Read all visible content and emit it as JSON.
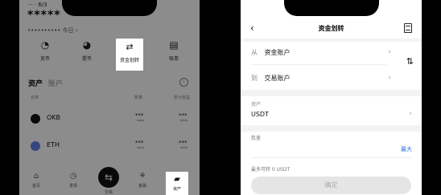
{
  "left": {
    "header_fragment": "··· · 6/3",
    "balance_masked": "*****",
    "balance_sub": "•••••••••• 今日 ›",
    "actions": [
      {
        "label": "充币",
        "icon": "deposit-icon"
      },
      {
        "label": "提币",
        "icon": "withdraw-icon"
      },
      {
        "label": "资金划转",
        "icon": "transfer-icon"
      },
      {
        "label": "账单",
        "icon": "bill-icon"
      }
    ],
    "tabs": {
      "active": "资产",
      "other": "账户"
    },
    "col_headers": {
      "name": "名称",
      "qty": "数量",
      "total": "累计收益"
    },
    "rows": [
      {
        "name": "OKB",
        "v1": "***",
        "v1b": "***",
        "v2": "***",
        "v2b": "***"
      },
      {
        "name": "ETH",
        "v1": "***",
        "v1b": "***",
        "v2": "***",
        "v2b": "***"
      }
    ],
    "nav": [
      {
        "label": "首页",
        "icon": "home-icon"
      },
      {
        "label": "发现",
        "icon": "discover-icon"
      },
      {
        "label": "交易",
        "icon": "trade-icon"
      },
      {
        "label": "金融",
        "icon": "finance-icon"
      },
      {
        "label": "资产",
        "icon": "wallet-icon"
      }
    ]
  },
  "right": {
    "title": "资金划转",
    "from_key": "从",
    "from_value": "资金账户",
    "to_key": "到",
    "to_value": "交易账户",
    "asset_label": "资产",
    "asset_value": "USDT",
    "qty_label": "数量",
    "max_label": "最大",
    "available": "最多可转 0 USDT",
    "confirm_label": "确定"
  }
}
